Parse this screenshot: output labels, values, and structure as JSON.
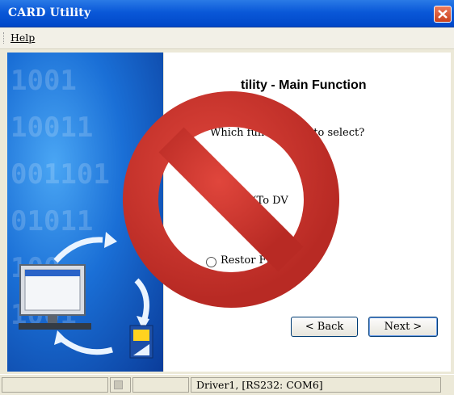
{
  "window": {
    "title": "CARD Utility"
  },
  "menu": {
    "help": "Help"
  },
  "panel": {
    "digits": [
      "1001",
      "10011",
      "001101",
      "01011",
      "100",
      "1001"
    ]
  },
  "main": {
    "heading": "tility - Main Function",
    "question": "Which fun                  ou want to select?",
    "option_backup": "p (To DV",
    "option_restore": "Restor                    File)"
  },
  "buttons": {
    "back": "< Back",
    "next": "Next >"
  },
  "status": {
    "driver": "Driver1, [RS232: COM6]"
  },
  "overlay": {
    "icon": "prohibited-icon",
    "color": "#d23a32"
  }
}
